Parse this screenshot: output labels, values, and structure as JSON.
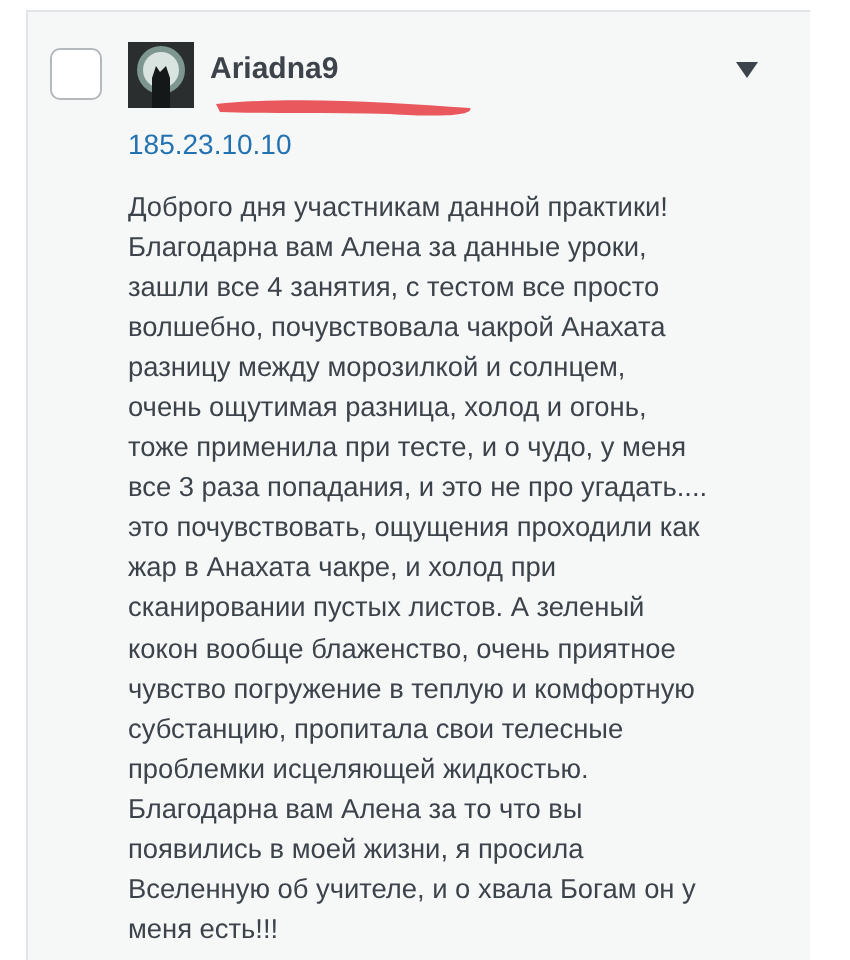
{
  "comment": {
    "selected": false,
    "author": "Ariadna9",
    "ip": "185.23.10.10",
    "text_lines": [
      "Доброго дня участникам данной практики!",
      "Благодарна вам Алена за данные уроки,",
      "зашли все 4 занятия, с тестом все просто",
      "волшебно, почувствовала чакрой Анахата",
      "разницу между морозилкой и солнцем,",
      "очень ощутимая разница, холод и огонь,",
      "тоже применила при тесте, и о чудо, у меня",
      "все 3 раза попадания, и это не про угадать....",
      "это почувствовать, ощущения проходили как",
      "жар в Анахата чакре, и холод при",
      "сканировании пустых листов. А зеленый",
      "кокон вообще блаженство, очень приятное",
      "чувство погружение в теплую и комфортную",
      "субстанцию, пропитала свои телесные",
      "проблемки исцеляющей жидкостью.",
      "Благодарна вам Алена за то что вы",
      "появились в моей жизни, я просила",
      "Вселенную об учителе, и о хвала Богам он у",
      "меня есть!!!"
    ]
  }
}
